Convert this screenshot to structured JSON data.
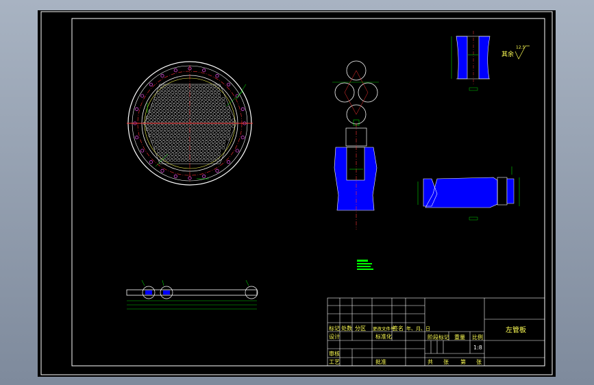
{
  "drawing": {
    "title": "左管板",
    "scale": "1:8",
    "surface_finish_label": "其余",
    "surface_finish_value": "12.5"
  },
  "title_block": {
    "row_revision": [
      "标记",
      "处数",
      "分区",
      "更改文件号",
      "签名",
      "年、月、日"
    ],
    "designer": "设计",
    "standardization": "标准化",
    "stage_mark": "阶段标记",
    "weight": "重量",
    "scale_label": "比例",
    "reviewer": "审核",
    "process": "工艺",
    "approve": "批准",
    "sheet_info": [
      "共",
      "张",
      "第",
      "张"
    ]
  },
  "colors": {
    "background": "#000000",
    "frame": "#ffffff",
    "title_text": "#ffff55",
    "section_fill": "#0000ff",
    "dimension": "#00ff00",
    "center_line": "#ff3333",
    "bolt_hole": "#ff00ff"
  }
}
